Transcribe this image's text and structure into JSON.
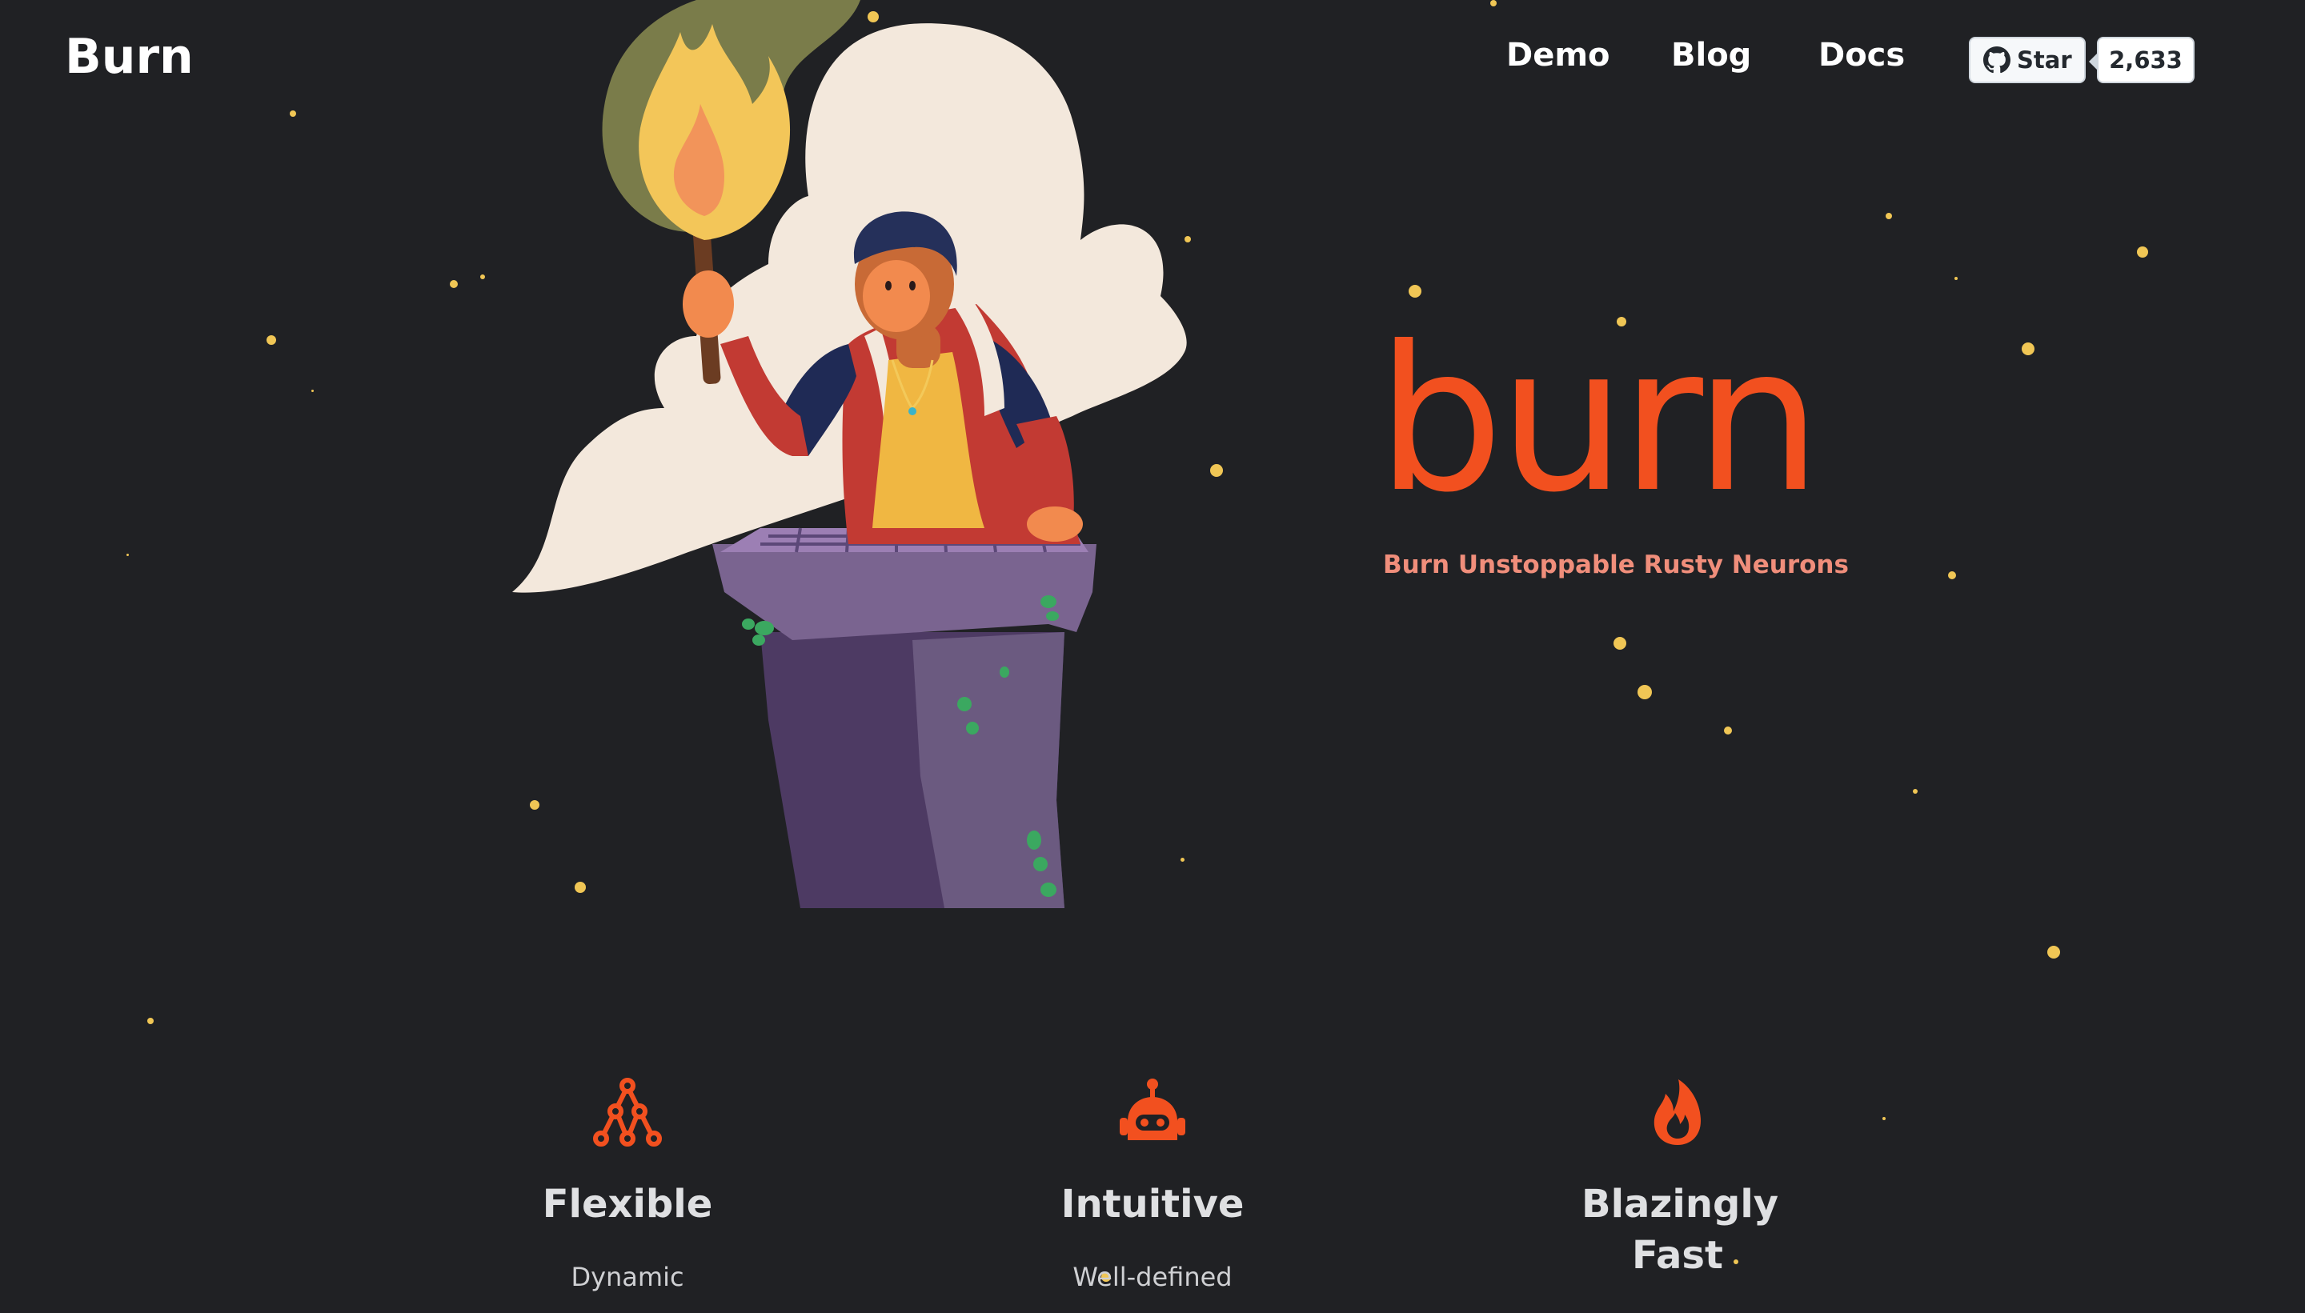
{
  "header": {
    "brand": "Burn",
    "nav": [
      "Demo",
      "Blog",
      "Docs"
    ],
    "github": {
      "star_label": "Star",
      "star_count": "2,633"
    }
  },
  "hero": {
    "logo_text": "burn",
    "tagline": "Burn Unstoppable Rusty Neurons"
  },
  "features": [
    {
      "title": "Flexible",
      "description": "Dynamic",
      "icon": "tree-nodes-icon"
    },
    {
      "title": "Intuitive",
      "description": "Well-defined",
      "icon": "robot-icon"
    },
    {
      "title": "Blazingly Fast",
      "description": "",
      "icon": "flame-icon"
    }
  ],
  "colors": {
    "background": "#202124",
    "accent": "#f2501f",
    "tagline": "#f08e7b",
    "star": "#f0c655"
  }
}
